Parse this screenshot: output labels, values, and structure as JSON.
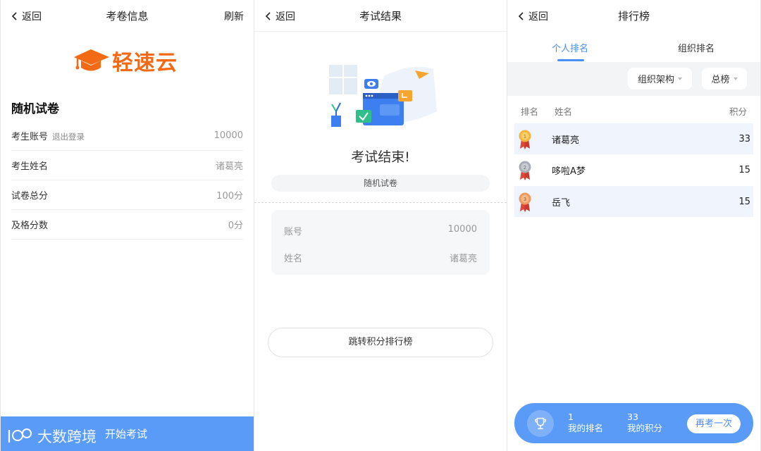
{
  "panel_info": {
    "back_label": "返回",
    "title": "考卷信息",
    "refresh_label": "刷新",
    "logo_text": "轻速云",
    "exam_name": "随机试卷",
    "rows": [
      {
        "label": "考生账号",
        "extra": "退出登录",
        "value": "10000"
      },
      {
        "label": "考生姓名",
        "value": "诸葛亮"
      },
      {
        "label": "试卷总分",
        "value": "100分"
      },
      {
        "label": "及格分数",
        "value": "0分"
      }
    ],
    "start_label": "开始考试",
    "watermark": "大数跨境"
  },
  "panel_result": {
    "back_label": "返回",
    "title": "考试结果",
    "done_text": "考试结束!",
    "paper_name": "随机试卷",
    "rows": [
      {
        "label": "账号",
        "value": "10000"
      },
      {
        "label": "姓名",
        "value": "诸葛亮"
      }
    ],
    "rank_button": "跳转积分排行榜"
  },
  "panel_rank": {
    "back_label": "返回",
    "title": "排行榜",
    "tabs": [
      {
        "label": "个人排名",
        "active": true
      },
      {
        "label": "组织排名",
        "active": false
      }
    ],
    "filters": {
      "org": "组织架构",
      "board": "总榜"
    },
    "columns": {
      "rank": "排名",
      "name": "姓名",
      "score": "积分"
    },
    "entries": [
      {
        "rank": "1",
        "name": "诸葛亮",
        "score": "33",
        "medal": "gold"
      },
      {
        "rank": "2",
        "name": "哆啦A梦",
        "score": "15",
        "medal": "silver"
      },
      {
        "rank": "3",
        "name": "岳飞",
        "score": "15",
        "medal": "bronze"
      }
    ],
    "my_rank_value": "1",
    "my_rank_label": "我的排名",
    "my_score_value": "33",
    "my_score_label": "我的积分",
    "retry_label": "再考一次"
  },
  "colors": {
    "brand_orange": "#f26a16",
    "primary_blue": "#5b9bf8",
    "tab_blue": "#4a8ef5",
    "row_highlight": "#eff4fd"
  }
}
